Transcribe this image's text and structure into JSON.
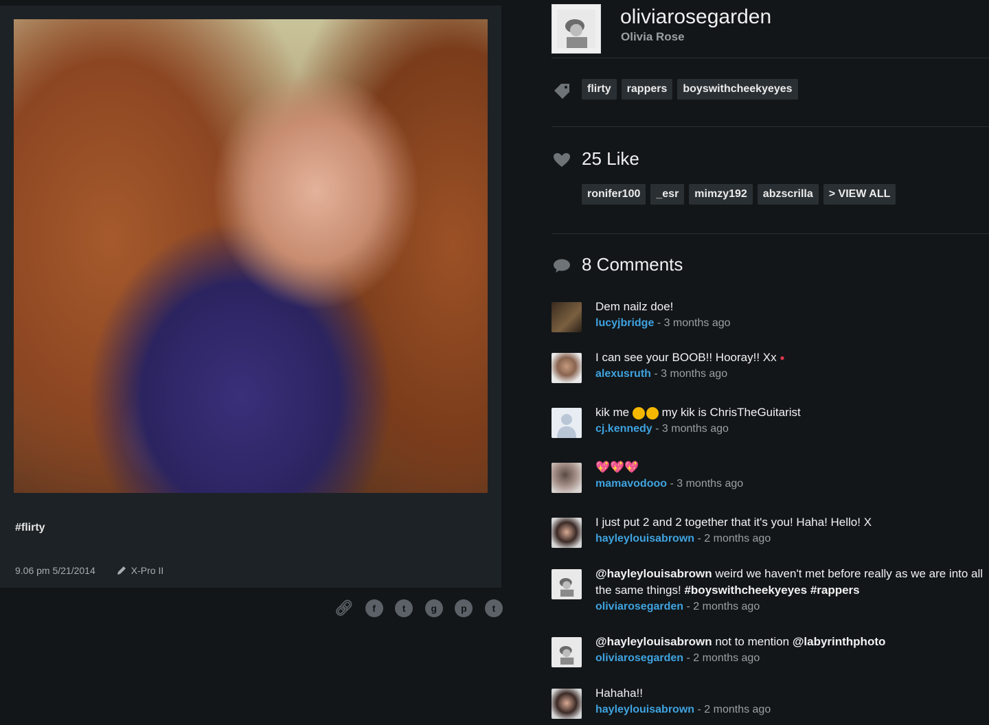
{
  "post": {
    "caption": "#flirty",
    "time": "9.06 pm 5/21/2014",
    "filter": "X-Pro II"
  },
  "share_icons": [
    "link-icon",
    "facebook-icon",
    "twitter-icon",
    "googleplus-icon",
    "pinterest-icon",
    "tumblr-icon"
  ],
  "profile": {
    "username": "oliviarosegarden",
    "full_name": "Olivia Rose"
  },
  "tags": [
    "flirty",
    "rappers",
    "boyswithcheekyeyes"
  ],
  "likes": {
    "count_label": "25 Like",
    "users": [
      "ronifer100",
      "_esr",
      "mimzy192",
      "abzscrilla"
    ],
    "view_all": "> VIEW ALL"
  },
  "comments": {
    "count_label": "8 Comments",
    "items": [
      {
        "text": "Dem nailz doe!",
        "user": "lucyjbridge",
        "when": "- 3 months ago"
      },
      {
        "text": "I can see your BOOB!! Hooray!! Xx",
        "user": "alexusruth",
        "when": "- 3 months ago"
      },
      {
        "text": "kik me",
        "text2": "my kik is ChrisTheGuitarist",
        "user": "cj.kennedy",
        "when": "- 3 months ago"
      },
      {
        "text": "💖💖💖",
        "user": "mamavodooo",
        "when": "- 3 months ago"
      },
      {
        "text": "I just put 2 and 2 together that it's you! Haha! Hello! X",
        "user": "hayleylouisabrown",
        "when": "- 2 months ago"
      },
      {
        "mention": "@hayleylouisabrown",
        "text": " weird we haven't met before really as we are into all the same things! ",
        "hash1": "#boyswithcheekyeyes",
        "hash2": "#rappers",
        "user": "oliviarosegarden",
        "when": "- 2 months ago"
      },
      {
        "mention": "@hayleylouisabrown",
        "text": " not to mention ",
        "mention2": "@labyrinthphoto",
        "user": "oliviarosegarden",
        "when": "- 2 months ago"
      },
      {
        "text": "Hahaha!!",
        "user": "hayleylouisabrown",
        "when": "- 2 months ago"
      }
    ]
  },
  "colors": {
    "background": "#121619",
    "card": "#1d2226",
    "chip": "#2a2f33",
    "link": "#3fa3e0",
    "muted": "#9aa0a4"
  }
}
